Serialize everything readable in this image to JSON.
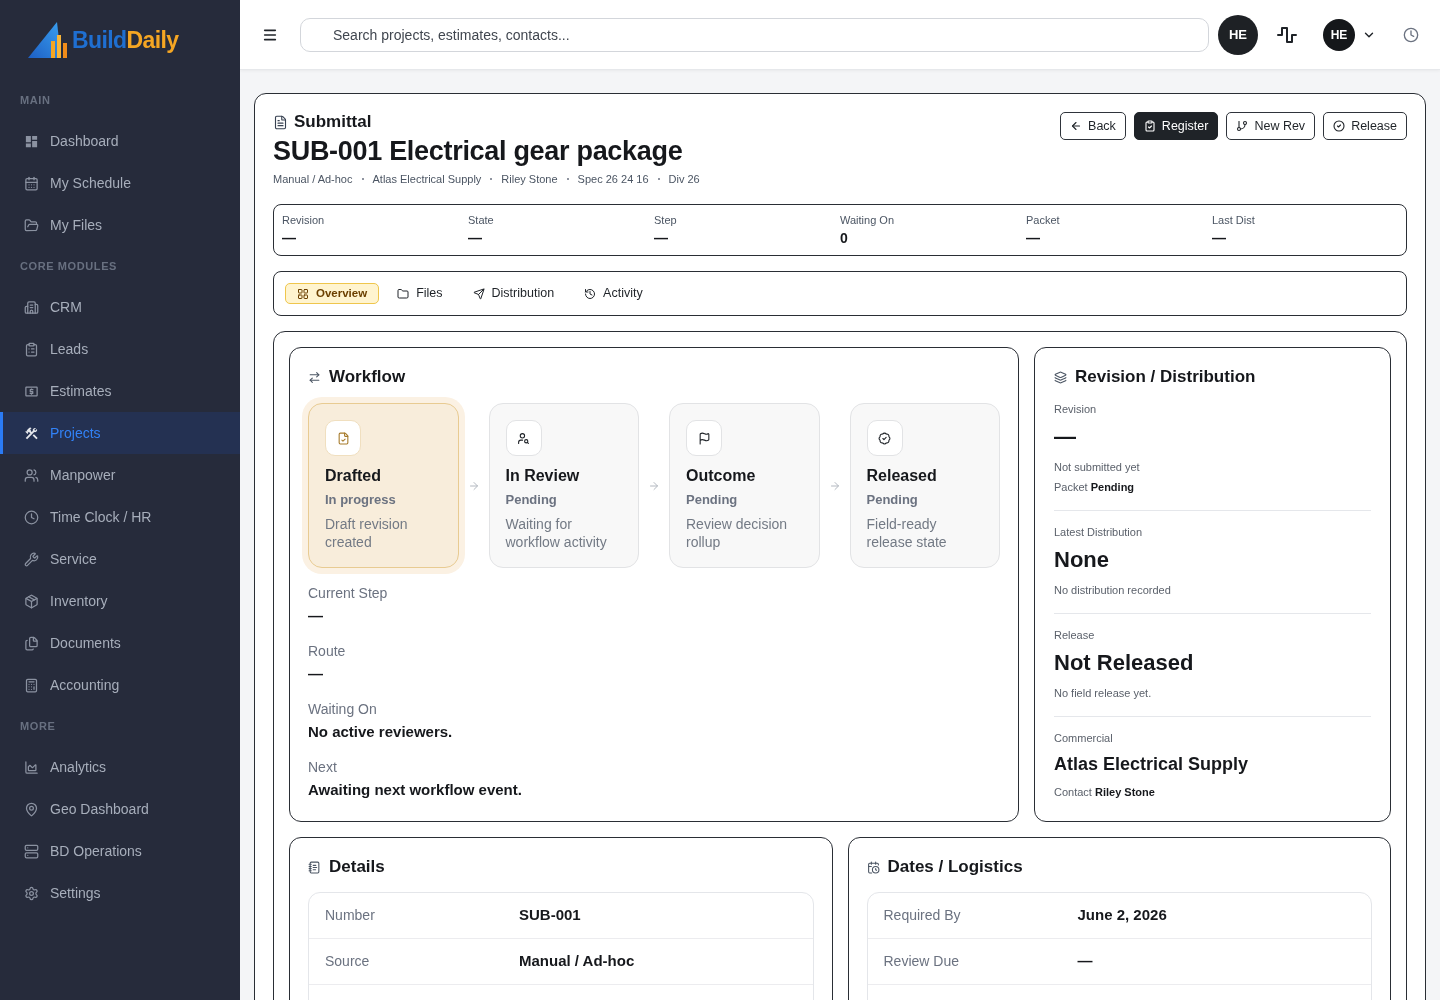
{
  "sidebar": {
    "logo_words": [
      "Build",
      "Daily"
    ],
    "sections": [
      {
        "label": "MAIN",
        "items": [
          {
            "label": "Dashboard",
            "selected": false
          },
          {
            "label": "My Schedule",
            "selected": false
          },
          {
            "label": "My Files",
            "selected": false
          }
        ]
      },
      {
        "label": "CORE MODULES",
        "items": [
          {
            "label": "CRM",
            "selected": false
          },
          {
            "label": "Leads",
            "selected": false
          },
          {
            "label": "Estimates",
            "selected": false
          },
          {
            "label": "Projects",
            "selected": true
          },
          {
            "label": "Manpower",
            "selected": false
          },
          {
            "label": "Time Clock / HR",
            "selected": false
          },
          {
            "label": "Service",
            "selected": false
          },
          {
            "label": "Inventory",
            "selected": false
          },
          {
            "label": "Documents",
            "selected": false
          },
          {
            "label": "Accounting",
            "selected": false
          }
        ]
      },
      {
        "label": "MORE",
        "items": [
          {
            "label": "Analytics",
            "selected": false
          },
          {
            "label": "Geo Dashboard",
            "selected": false
          },
          {
            "label": "BD Operations",
            "selected": false
          },
          {
            "label": "Settings",
            "selected": false
          }
        ]
      }
    ]
  },
  "header": {
    "search": {
      "placeholder": "Search projects, estimates, contacts..."
    },
    "avatars": [
      "HE",
      "HE"
    ]
  },
  "submittal": {
    "eyebrow": "Submittal",
    "title": "SUB-001 Electrical gear package",
    "meta": [
      "Manual / Ad-hoc",
      "Atlas Electrical Supply",
      "Riley Stone",
      "Spec 26 24 16",
      "Div 26"
    ],
    "actions": [
      {
        "label": "Back",
        "kind": "outline"
      },
      {
        "label": "Register",
        "kind": "filled"
      },
      {
        "label": "New Rev",
        "kind": "outline"
      },
      {
        "label": "Release",
        "kind": "outline"
      }
    ],
    "stats": [
      {
        "label": "Revision",
        "value": "—"
      },
      {
        "label": "State",
        "value": "—"
      },
      {
        "label": "Step",
        "value": "—"
      },
      {
        "label": "Waiting On",
        "value": "0"
      },
      {
        "label": "Packet",
        "value": "—"
      },
      {
        "label": "Last Dist",
        "value": "—"
      }
    ],
    "tabs": [
      {
        "label": "Overview",
        "selected": true
      },
      {
        "label": "Files",
        "selected": false
      },
      {
        "label": "Distribution",
        "selected": false
      },
      {
        "label": "Activity",
        "selected": false
      }
    ]
  },
  "workflow": {
    "title": "Workflow",
    "steps": [
      {
        "title": "Drafted",
        "status": "In progress",
        "description": "Draft revision created",
        "active": true
      },
      {
        "title": "In Review",
        "status": "Pending",
        "description": "Waiting for workflow activity",
        "active": false
      },
      {
        "title": "Outcome",
        "status": "Pending",
        "description": "Review decision rollup",
        "active": false
      },
      {
        "title": "Released",
        "status": "Pending",
        "description": "Field-ready release state",
        "active": false
      }
    ],
    "fields": [
      {
        "label": "Current Step",
        "value": "—"
      },
      {
        "label": "Route",
        "value": "—"
      },
      {
        "label": "Waiting On",
        "value": "No active reviewers."
      },
      {
        "label": "Next",
        "value": "Awaiting next workflow event."
      }
    ]
  },
  "revision_distribution": {
    "title": "Revision / Distribution",
    "sections": [
      {
        "label": "Revision",
        "value": "—",
        "kind": "headline",
        "notes": [
          "Not submitted yet",
          "Packet **Pending**"
        ]
      },
      {
        "label": "Latest Distribution",
        "value": "None",
        "kind": "headline",
        "notes": [
          "No distribution recorded"
        ]
      },
      {
        "label": "Release",
        "value": "Not Released",
        "kind": "headline",
        "notes": [
          "No field release yet."
        ]
      },
      {
        "label": "Commercial",
        "value": "Atlas Electrical Supply",
        "kind": "name",
        "notes": [
          "Contact **Riley Stone**"
        ]
      }
    ]
  },
  "details": {
    "title": "Details",
    "rows": [
      {
        "label": "Number",
        "value": "SUB-001"
      },
      {
        "label": "Source",
        "value": "Manual / Ad-hoc"
      }
    ]
  },
  "dates_logistics": {
    "title": "Dates / Logistics",
    "rows": [
      {
        "label": "Required By",
        "value": "June 2, 2026"
      },
      {
        "label": "Review Due",
        "value": "—"
      }
    ]
  }
}
